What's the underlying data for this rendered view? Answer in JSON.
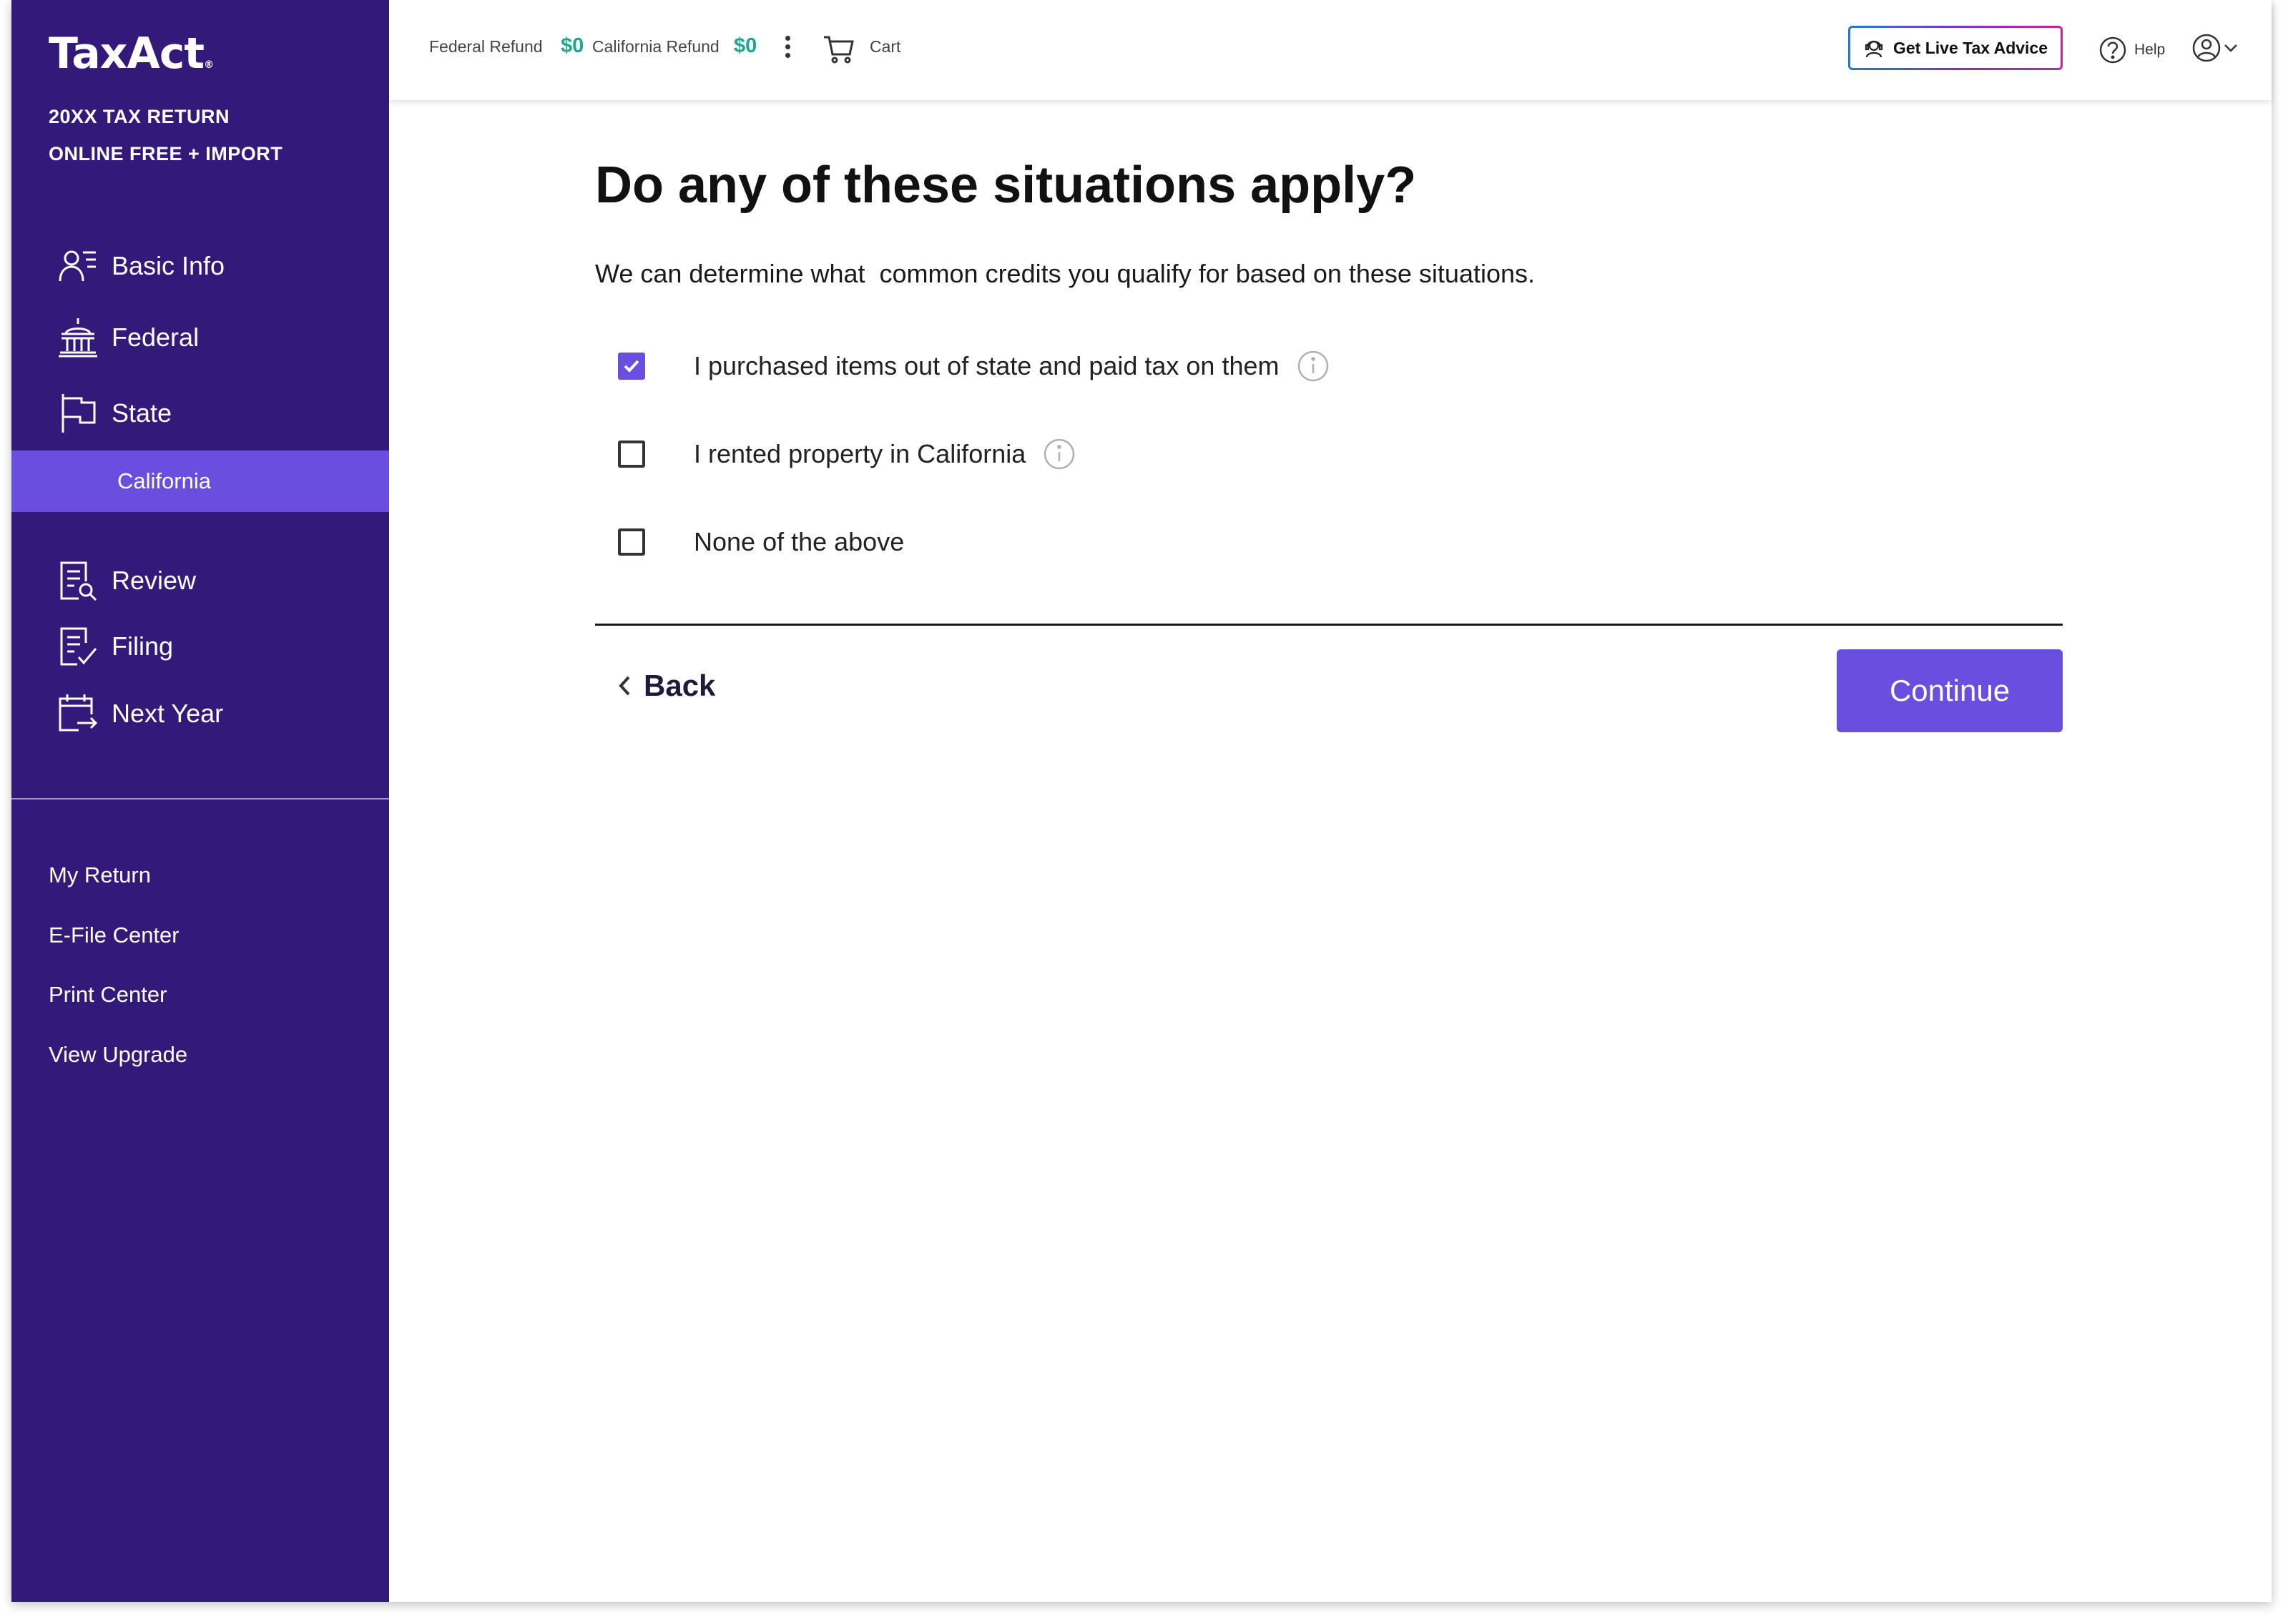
{
  "brand": {
    "logo": "TaxAct",
    "trademark": "®"
  },
  "return_info": {
    "line1": "20XX TAX RETURN",
    "line2": "ONLINE FREE + IMPORT"
  },
  "sidebar": {
    "nav": [
      {
        "label": "Basic Info",
        "icon": "user-list-icon"
      },
      {
        "label": "Federal",
        "icon": "capitol-building-icon"
      },
      {
        "label": "State",
        "icon": "flag-icon"
      },
      {
        "label": "Review",
        "icon": "document-search-icon"
      },
      {
        "label": "Filing",
        "icon": "document-check-icon"
      },
      {
        "label": "Next Year",
        "icon": "calendar-arrow-icon"
      }
    ],
    "active_sub": "California",
    "links": [
      "My Return",
      "E-File Center",
      "Print Center",
      "View Upgrade"
    ]
  },
  "topbar": {
    "federal_label": "Federal Refund",
    "federal_amount": "$0",
    "state_label": "California Refund",
    "state_amount": "$0",
    "cart_label": "Cart",
    "advice_label": "Get Live Tax Advice",
    "help_label": "Help"
  },
  "main": {
    "title": "Do any of these situations apply?",
    "subtitle": "We can determine what  common credits you qualify for based on these situations.",
    "options": [
      {
        "label": "I purchased items out of state and paid tax on them",
        "checked": true,
        "info": true
      },
      {
        "label": "I rented property in California",
        "checked": false,
        "info": true
      },
      {
        "label": "None of the above",
        "checked": false,
        "info": false
      }
    ],
    "back_label": "Back",
    "continue_label": "Continue"
  },
  "colors": {
    "sidebar_bg": "#331a7a",
    "active_bg": "#6a4ee0",
    "accent": "#6a4ee0",
    "refund_amount": "#1aa892"
  }
}
